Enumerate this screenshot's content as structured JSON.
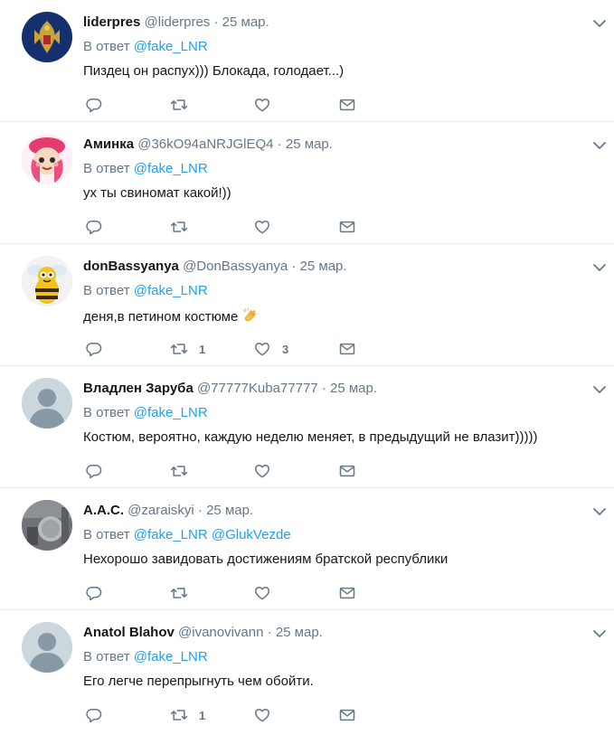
{
  "reply_to_prefix": "В ответ",
  "colors": {
    "link": "#1da1f2",
    "secondary": "#657786",
    "text": "#14171a",
    "divider": "#e6ecf0"
  },
  "tweets": [
    {
      "name": "liderpres",
      "handle": "@liderpres",
      "dot": "·",
      "time": "25 мар.",
      "mentions": [
        "@fake_LNR"
      ],
      "text": "Пиздец он распух))) Блокада, голодает...)",
      "retweets": "",
      "likes": "",
      "avatar": "emblem"
    },
    {
      "name": "Аминка",
      "handle": "@36kO94aNRJGlEQ4",
      "dot": "·",
      "time": "25 мар.",
      "mentions": [
        "@fake_LNR"
      ],
      "text": "ух ты свиномат какой!))",
      "retweets": "",
      "likes": "",
      "avatar": "cartoon-girl"
    },
    {
      "name": "donBassyanya",
      "handle": "@DonBassyanya",
      "dot": "·",
      "time": "25 мар.",
      "mentions": [
        "@fake_LNR"
      ],
      "text": "деня,в петином костюме",
      "emoji": "clapping-hands",
      "retweets": "1",
      "likes": "3",
      "avatar": "bee"
    },
    {
      "name": "Владлен Заруба",
      "handle": "@77777Kuba77777",
      "dot": "·",
      "time": "25 мар.",
      "mentions": [
        "@fake_LNR"
      ],
      "text": "Костюм, вероятно, каждую неделю меняет, в предыдущий не влазит)))))",
      "retweets": "",
      "likes": "",
      "avatar": "default"
    },
    {
      "name": "A.A.C.",
      "handle": "@zaraiskyi",
      "dot": "·",
      "time": "25 мар.",
      "mentions": [
        "@fake_LNR",
        "@GlukVezde"
      ],
      "text": "Нехорошо завидовать достижениям братской республики",
      "retweets": "",
      "likes": "",
      "avatar": "photo"
    },
    {
      "name": "Anatol Blahov",
      "handle": "@ivanovivann",
      "dot": "·",
      "time": "25 мар.",
      "mentions": [
        "@fake_LNR"
      ],
      "text": "Его легче перепрыгнуть чем обойти.",
      "retweets": "1",
      "likes": "",
      "avatar": "default"
    }
  ]
}
